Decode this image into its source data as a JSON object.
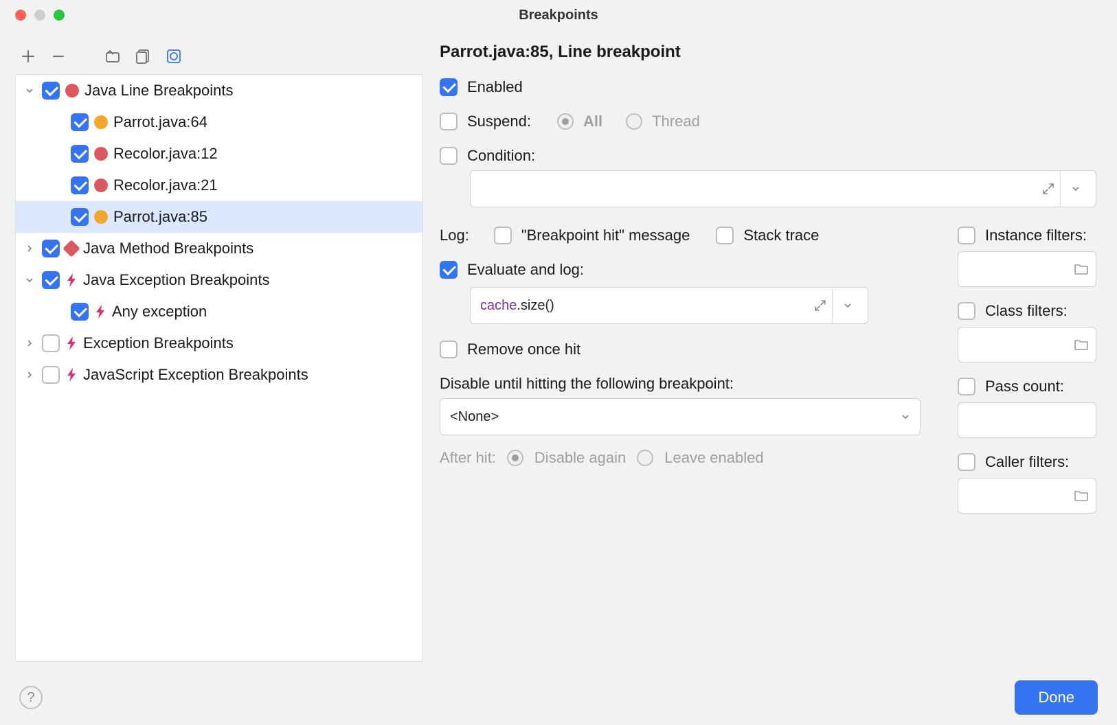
{
  "window": {
    "title": "Breakpoints"
  },
  "tree": {
    "javaLine": {
      "label": "Java Line Breakpoints",
      "checked": true,
      "items": [
        {
          "label": "Parrot.java:64",
          "checked": true,
          "color": "yellow"
        },
        {
          "label": "Recolor.java:12",
          "checked": true,
          "color": "red"
        },
        {
          "label": "Recolor.java:21",
          "checked": true,
          "color": "red"
        },
        {
          "label": "Parrot.java:85",
          "checked": true,
          "color": "yellow",
          "selected": true
        }
      ]
    },
    "javaMethod": {
      "label": "Java Method Breakpoints",
      "checked": true
    },
    "javaException": {
      "label": "Java Exception Breakpoints",
      "checked": true,
      "items": [
        {
          "label": "Any exception",
          "checked": true
        }
      ]
    },
    "exception": {
      "label": "Exception Breakpoints",
      "checked": false
    },
    "jsException": {
      "label": "JavaScript Exception Breakpoints",
      "checked": false
    }
  },
  "details": {
    "heading": "Parrot.java:85, Line breakpoint",
    "enabled": {
      "label": "Enabled",
      "checked": true
    },
    "suspend": {
      "label": "Suspend:",
      "checked": false,
      "all_label": "All",
      "thread_label": "Thread"
    },
    "condition": {
      "label": "Condition:",
      "checked": false,
      "value": ""
    },
    "log_label": "Log:",
    "bpHit": {
      "label": "\"Breakpoint hit\" message",
      "checked": false
    },
    "stackTrace": {
      "label": "Stack trace",
      "checked": false
    },
    "evaluateAndLog": {
      "label": "Evaluate and log:",
      "checked": true,
      "value_kw": "cache",
      "value_rest": ".size()"
    },
    "removeOnceHit": {
      "label": "Remove once hit",
      "checked": false
    },
    "disableUntil": {
      "label": "Disable until hitting the following breakpoint:",
      "value": "<None>"
    },
    "afterHit": {
      "label": "After hit:",
      "disable_again": "Disable again",
      "leave_enabled": "Leave enabled"
    },
    "filters": {
      "instance": {
        "label": "Instance filters:",
        "checked": false
      },
      "class": {
        "label": "Class filters:",
        "checked": false
      },
      "passCount": {
        "label": "Pass count:",
        "checked": false
      },
      "caller": {
        "label": "Caller filters:",
        "checked": false
      }
    }
  },
  "footer": {
    "done": "Done"
  }
}
